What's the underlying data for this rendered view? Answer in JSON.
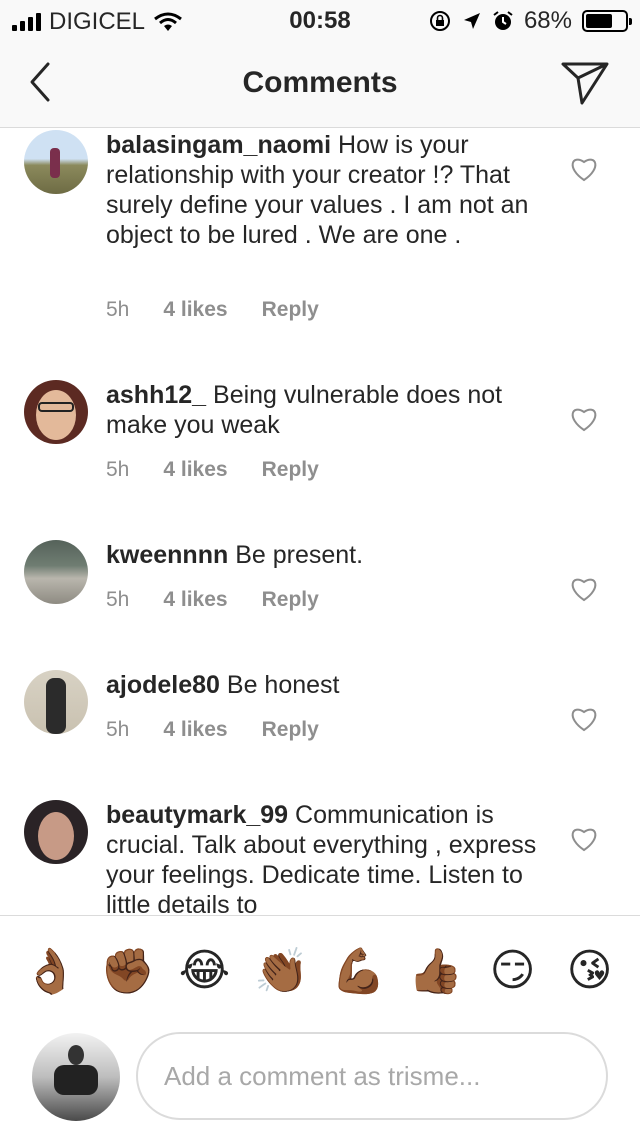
{
  "status_bar": {
    "carrier": "DIGICEL",
    "time": "00:58",
    "battery": "68%",
    "battery_level": 0.68
  },
  "nav": {
    "title": "Comments"
  },
  "comments": [
    {
      "username": "balasingam_naomi",
      "text": "How is your relationship with your creator !? That surely define your values . I am not an object to be lured . We are one .",
      "time": "5h",
      "likes": "4 likes",
      "reply": "Reply"
    },
    {
      "username": "ashh12_",
      "text": "Being vulnerable does not make you weak",
      "time": "5h",
      "likes": "4 likes",
      "reply": "Reply"
    },
    {
      "username": "kweennnn",
      "text": "Be present.",
      "time": "5h",
      "likes": "4 likes",
      "reply": "Reply"
    },
    {
      "username": "ajodele80",
      "text": "Be honest",
      "time": "5h",
      "likes": "4 likes",
      "reply": "Reply"
    },
    {
      "username": "beautymark_99",
      "text": "Communication is crucial. Talk about everything , express your feelings. Dedicate time. Listen to little details to"
    }
  ],
  "emojis": [
    "👌🏾",
    "✊🏾",
    "😂",
    "👏🏾",
    "💪🏾",
    "👍🏾",
    "😏",
    "😘"
  ],
  "composer": {
    "placeholder": "Add a comment as trisme..."
  },
  "colors": {
    "text": "#262626",
    "meta": "#8e8e8e",
    "divider": "#dbdbdb",
    "bar_bg": "#f9f9f9"
  }
}
